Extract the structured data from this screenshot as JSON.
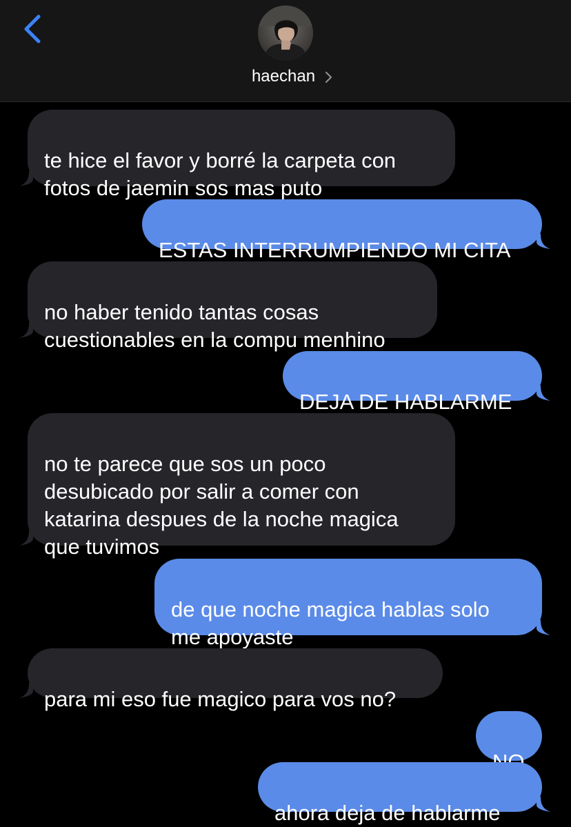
{
  "header": {
    "contact_name": "haechan",
    "back_icon": "chevron-left-icon",
    "detail_icon": "chevron-right-icon"
  },
  "colors": {
    "header_bg": "#161616",
    "accent": "#3b82f6",
    "sent_bubble": "#5b8be8",
    "received_bubble": "#26252a",
    "background": "#000000"
  },
  "messages": [
    {
      "direction": "received",
      "text": "te hice el favor y borré la carpeta con\nfotos de jaemin sos mas puto"
    },
    {
      "direction": "sent",
      "text": "ESTAS INTERRUMPIENDO MI CITA"
    },
    {
      "direction": "received",
      "text": "no haber tenido tantas cosas\ncuestionables en la compu menhino"
    },
    {
      "direction": "sent",
      "text": "DEJA DE HABLARME"
    },
    {
      "direction": "received",
      "text": "no te parece que sos un poco\ndesubicado por salir a comer con\nkatarina despues de la noche magica\nque tuvimos"
    },
    {
      "direction": "sent",
      "text": "de que noche magica hablas solo\nme apoyaste"
    },
    {
      "direction": "received",
      "text": "para mi eso fue magico para vos no?"
    },
    {
      "direction": "sent",
      "text": "NO"
    },
    {
      "direction": "sent",
      "text": "ahora deja de hablarme"
    }
  ]
}
